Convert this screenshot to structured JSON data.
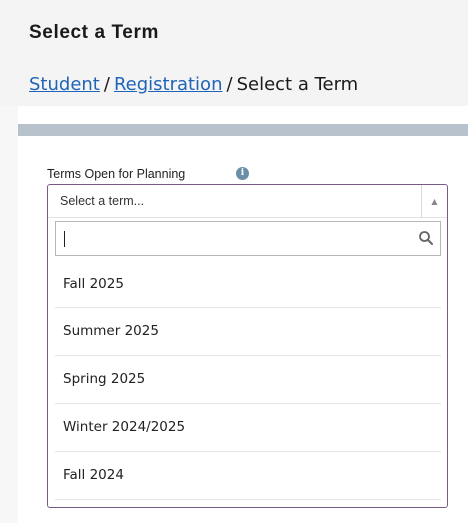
{
  "header": {
    "title": "Select a Term",
    "breadcrumb": {
      "student": "Student",
      "registration": "Registration",
      "current": "Select a Term",
      "separator": "/"
    }
  },
  "term_field": {
    "label": "Terms Open for Planning",
    "info_icon": "info-icon",
    "selected_placeholder": "Select a term...",
    "search_value": "",
    "options": [
      "Fall 2025",
      "Summer 2025",
      "Spring 2025",
      "Winter 2024/2025",
      "Fall 2024"
    ]
  },
  "colors": {
    "link": "#1f64b8",
    "dropdown_border": "#7a5a86",
    "panel_accent": "#b8c2cc"
  }
}
